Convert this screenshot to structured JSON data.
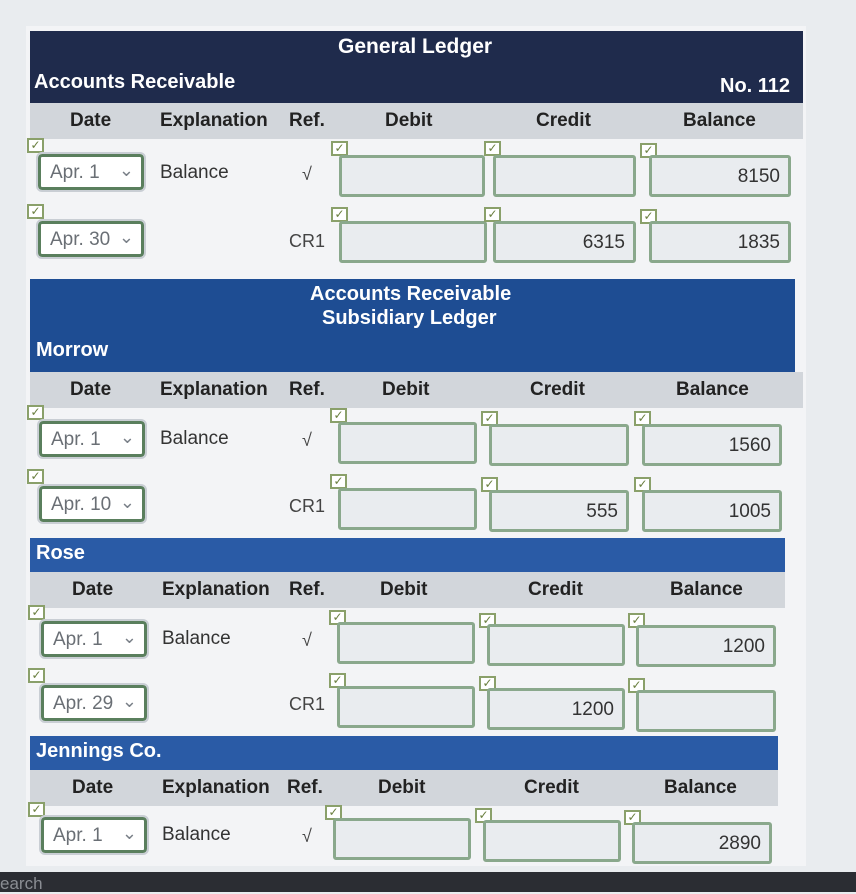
{
  "general_ledger": {
    "title": "General Ledger",
    "account_name": "Accounts Receivable",
    "account_no": "No. 112",
    "columns": [
      "Date",
      "Explanation",
      "Ref.",
      "Debit",
      "Credit",
      "Balance"
    ],
    "rows": [
      {
        "date": "Apr. 1",
        "explanation": "Balance",
        "ref": "√",
        "debit": "",
        "credit": "",
        "balance": "8150"
      },
      {
        "date": "Apr. 30",
        "explanation": "",
        "ref": "CR1",
        "debit": "",
        "credit": "6315",
        "balance": "1835"
      }
    ]
  },
  "subsidiary": {
    "title_line1": "Accounts Receivable",
    "title_line2": "Subsidiary Ledger",
    "accounts": [
      {
        "name": "Morrow",
        "columns": [
          "Date",
          "Explanation",
          "Ref.",
          "Debit",
          "Credit",
          "Balance"
        ],
        "rows": [
          {
            "date": "Apr. 1",
            "explanation": "Balance",
            "ref": "√",
            "debit": "",
            "credit": "",
            "balance": "1560"
          },
          {
            "date": "Apr. 10",
            "explanation": "",
            "ref": "CR1",
            "debit": "",
            "credit": "555",
            "balance": "1005"
          }
        ]
      },
      {
        "name": "Rose",
        "columns": [
          "Date",
          "Explanation",
          "Ref.",
          "Debit",
          "Credit",
          "Balance"
        ],
        "rows": [
          {
            "date": "Apr. 1",
            "explanation": "Balance",
            "ref": "√",
            "debit": "",
            "credit": "",
            "balance": "1200"
          },
          {
            "date": "Apr. 29",
            "explanation": "",
            "ref": "CR1",
            "debit": "",
            "credit": "1200",
            "balance": ""
          }
        ]
      },
      {
        "name": "Jennings Co.",
        "columns": [
          "Date",
          "Explanation",
          "Ref.",
          "Debit",
          "Credit",
          "Balance"
        ],
        "rows": [
          {
            "date": "Apr. 1",
            "explanation": "Balance",
            "ref": "√",
            "debit": "",
            "credit": "",
            "balance": "2890"
          }
        ]
      }
    ]
  },
  "taskbar": {
    "search_text": "earch"
  },
  "icons": {
    "dropdown": "chevron-down-icon",
    "check": "checkmark-icon"
  }
}
